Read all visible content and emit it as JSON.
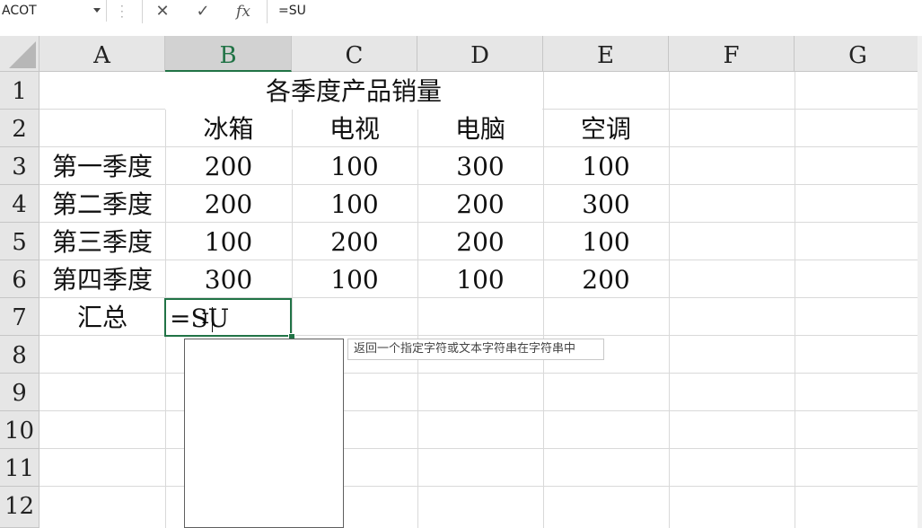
{
  "formula_bar": {
    "name_box": "ACOT",
    "cancel_icon": "✕",
    "enter_icon": "✓",
    "fx_label": "fx",
    "formula": "=SU"
  },
  "columns": [
    "A",
    "B",
    "C",
    "D",
    "E",
    "F",
    "G"
  ],
  "selected_column": "B",
  "rows": [
    "1",
    "2",
    "3",
    "4",
    "5",
    "6",
    "7",
    "8",
    "9",
    "10",
    "11",
    "12"
  ],
  "sheet": {
    "title": "各季度产品销量",
    "headers": [
      "冰箱",
      "电视",
      "电脑",
      "空调"
    ],
    "data_rows": [
      {
        "label": "第一季度",
        "values": [
          "200",
          "100",
          "300",
          "100"
        ]
      },
      {
        "label": "第二季度",
        "values": [
          "200",
          "100",
          "200",
          "300"
        ]
      },
      {
        "label": "第三季度",
        "values": [
          "100",
          "200",
          "200",
          "100"
        ]
      },
      {
        "label": "第四季度",
        "values": [
          "300",
          "100",
          "100",
          "200"
        ]
      }
    ],
    "summary_label": "汇总",
    "active_cell_text": "=SU"
  },
  "autocomplete": {
    "tooltip": "返回一个指定字符或文本字符串在字符串中"
  },
  "colors": {
    "accent": "#217346",
    "header_bg": "#e6e6e6",
    "gridline": "#d9d9d9"
  }
}
